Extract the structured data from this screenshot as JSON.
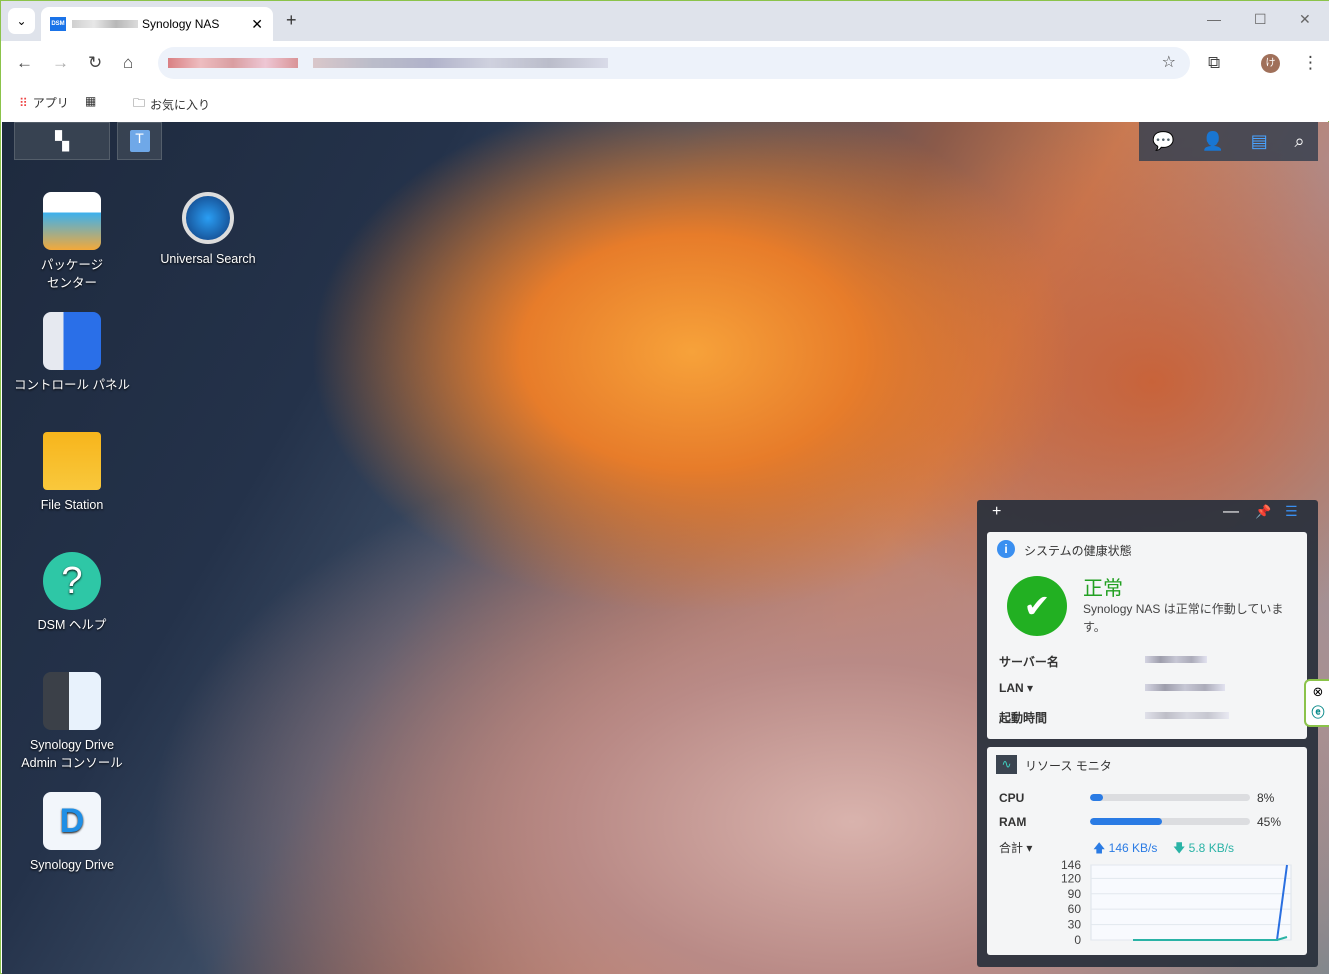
{
  "browser": {
    "tab_title": "Synology NAS",
    "tab_favicon": "DSM",
    "bookmarks": {
      "apps": "アプリ",
      "favorites": "お気に入り"
    }
  },
  "desktop": {
    "icons": [
      {
        "label": "パッケージ\nセンター",
        "icon": "package-center-icon"
      },
      {
        "label": "Universal Search",
        "icon": "universal-search-icon"
      },
      {
        "label": "コントロール パネル",
        "icon": "control-panel-icon"
      },
      {
        "label": "File Station",
        "icon": "file-station-icon"
      },
      {
        "label": "DSM ヘルプ",
        "icon": "dsm-help-icon"
      },
      {
        "label": "Synology Drive\nAdmin コンソール",
        "icon": "drive-admin-icon"
      },
      {
        "label": "Synology Drive",
        "icon": "synology-drive-icon"
      }
    ]
  },
  "health": {
    "title": "システムの健康状態",
    "status": "正常",
    "message": "Synology NAS は正常に作動しています。",
    "rows": [
      {
        "label": "サーバー名"
      },
      {
        "label": "LAN"
      },
      {
        "label": "起動時間"
      }
    ],
    "status_color": "#22b022"
  },
  "resource": {
    "title": "リソース モニタ",
    "cpu_label": "CPU",
    "cpu_percent": 8,
    "cpu_text": "8%",
    "ram_label": "RAM",
    "ram_percent": 45,
    "ram_text": "45%",
    "net_label": "合計",
    "upload": "146 KB/s",
    "download": "5.8 KB/s"
  },
  "chart_data": {
    "type": "line",
    "y_ticks": [
      "146",
      "120",
      "90",
      "60",
      "30",
      "0"
    ],
    "ylim": [
      0,
      146
    ],
    "series": [
      {
        "values": [
          0,
          0,
          0,
          0,
          0,
          0,
          0,
          0,
          0,
          0,
          0,
          146
        ],
        "color": "#2a6fe0"
      },
      {
        "values": [
          0,
          0,
          0,
          0,
          0,
          0,
          0,
          0,
          0,
          0,
          0,
          5.8
        ],
        "color": "#2ab3a6"
      }
    ]
  }
}
